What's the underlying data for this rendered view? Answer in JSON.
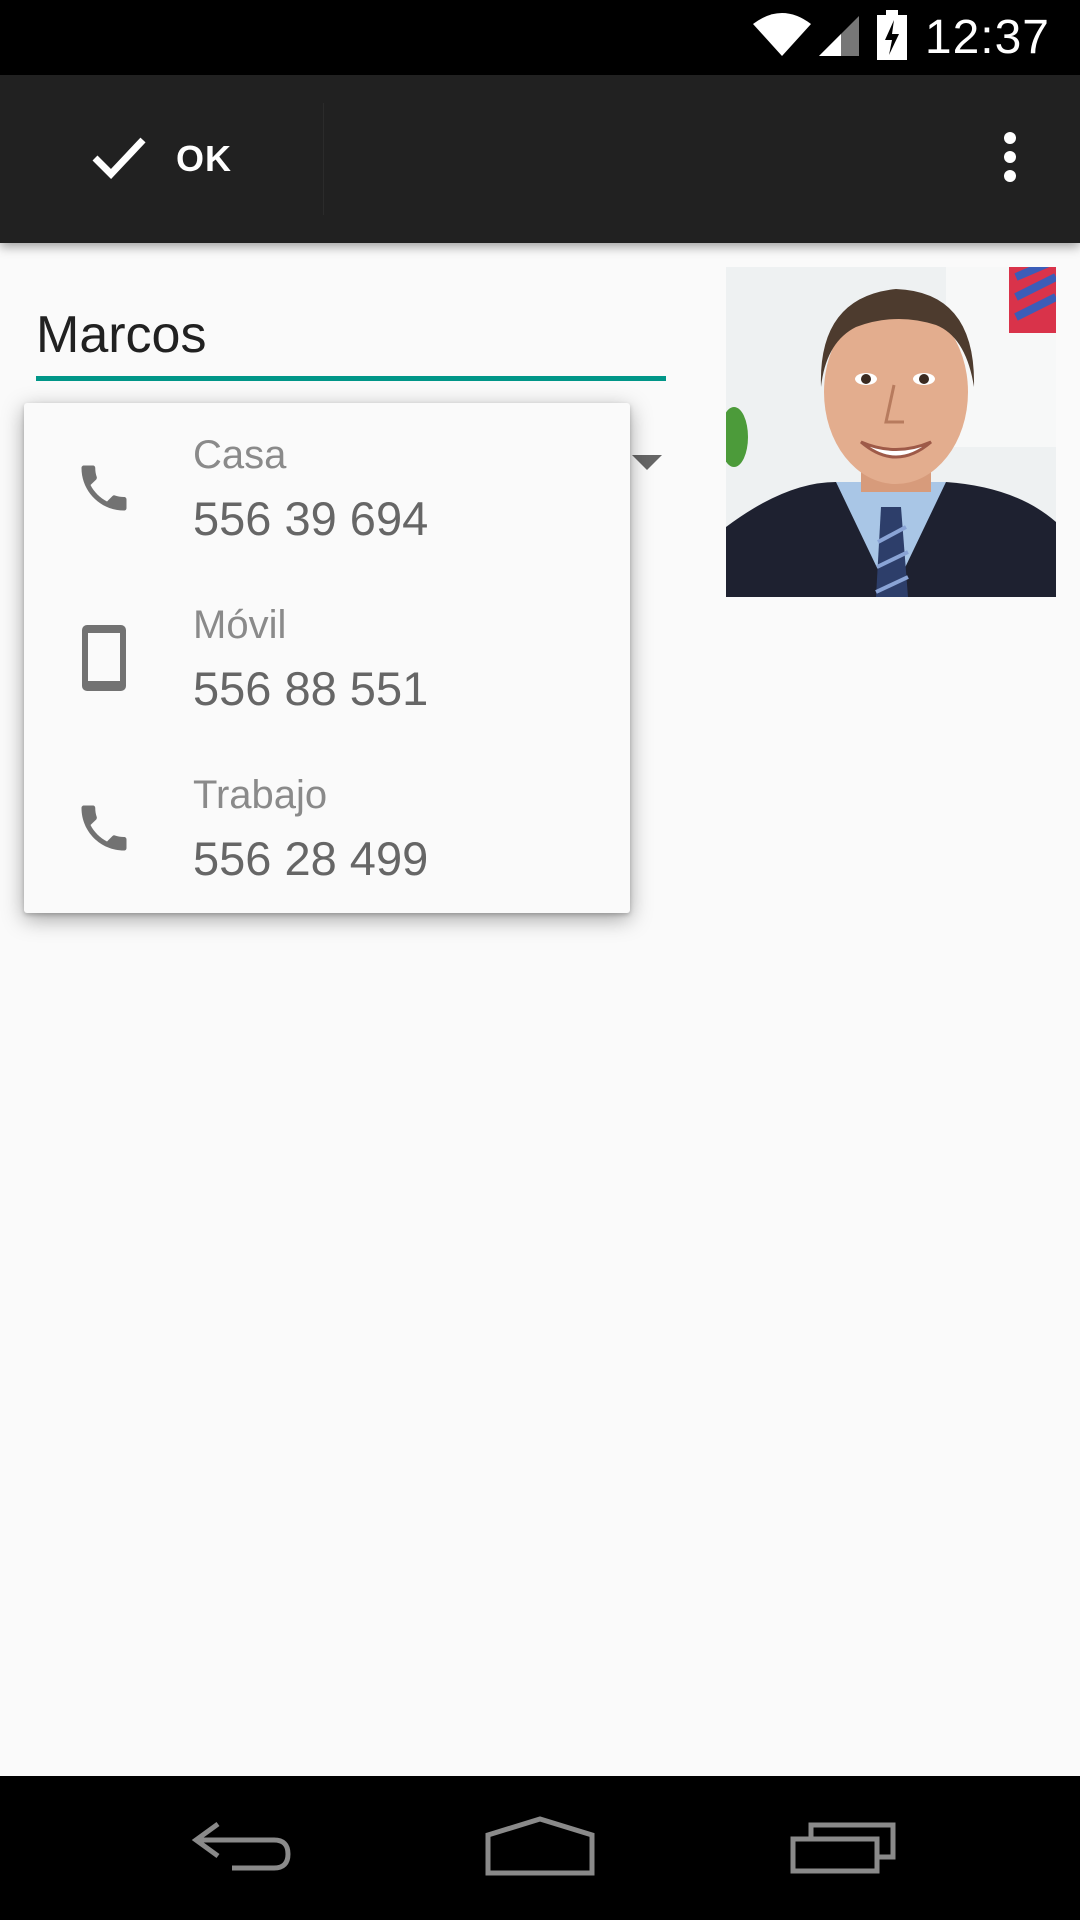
{
  "status_bar": {
    "time": "12:37",
    "icons": [
      "wifi-icon",
      "signal-icon",
      "battery-charging-icon"
    ]
  },
  "action_bar": {
    "ok_label": "OK",
    "ok_icon": "check-icon",
    "overflow_icon": "more-vert-icon"
  },
  "contact": {
    "name_value": "Marcos",
    "photo": "contact-photo"
  },
  "colors": {
    "accent": "#009688",
    "action_bar": "#212121",
    "status_bar": "#000000",
    "background": "#fafafa"
  },
  "phone_popup": {
    "items": [
      {
        "type": "Casa",
        "number": "556 39 694",
        "icon": "phone-icon"
      },
      {
        "type": "Móvil",
        "number": "556 88 551",
        "icon": "smartphone-icon"
      },
      {
        "type": "Trabajo",
        "number": "556 28 499",
        "icon": "phone-icon"
      }
    ]
  },
  "nav_bar": {
    "buttons": [
      "back-icon",
      "home-icon",
      "recents-icon"
    ]
  }
}
